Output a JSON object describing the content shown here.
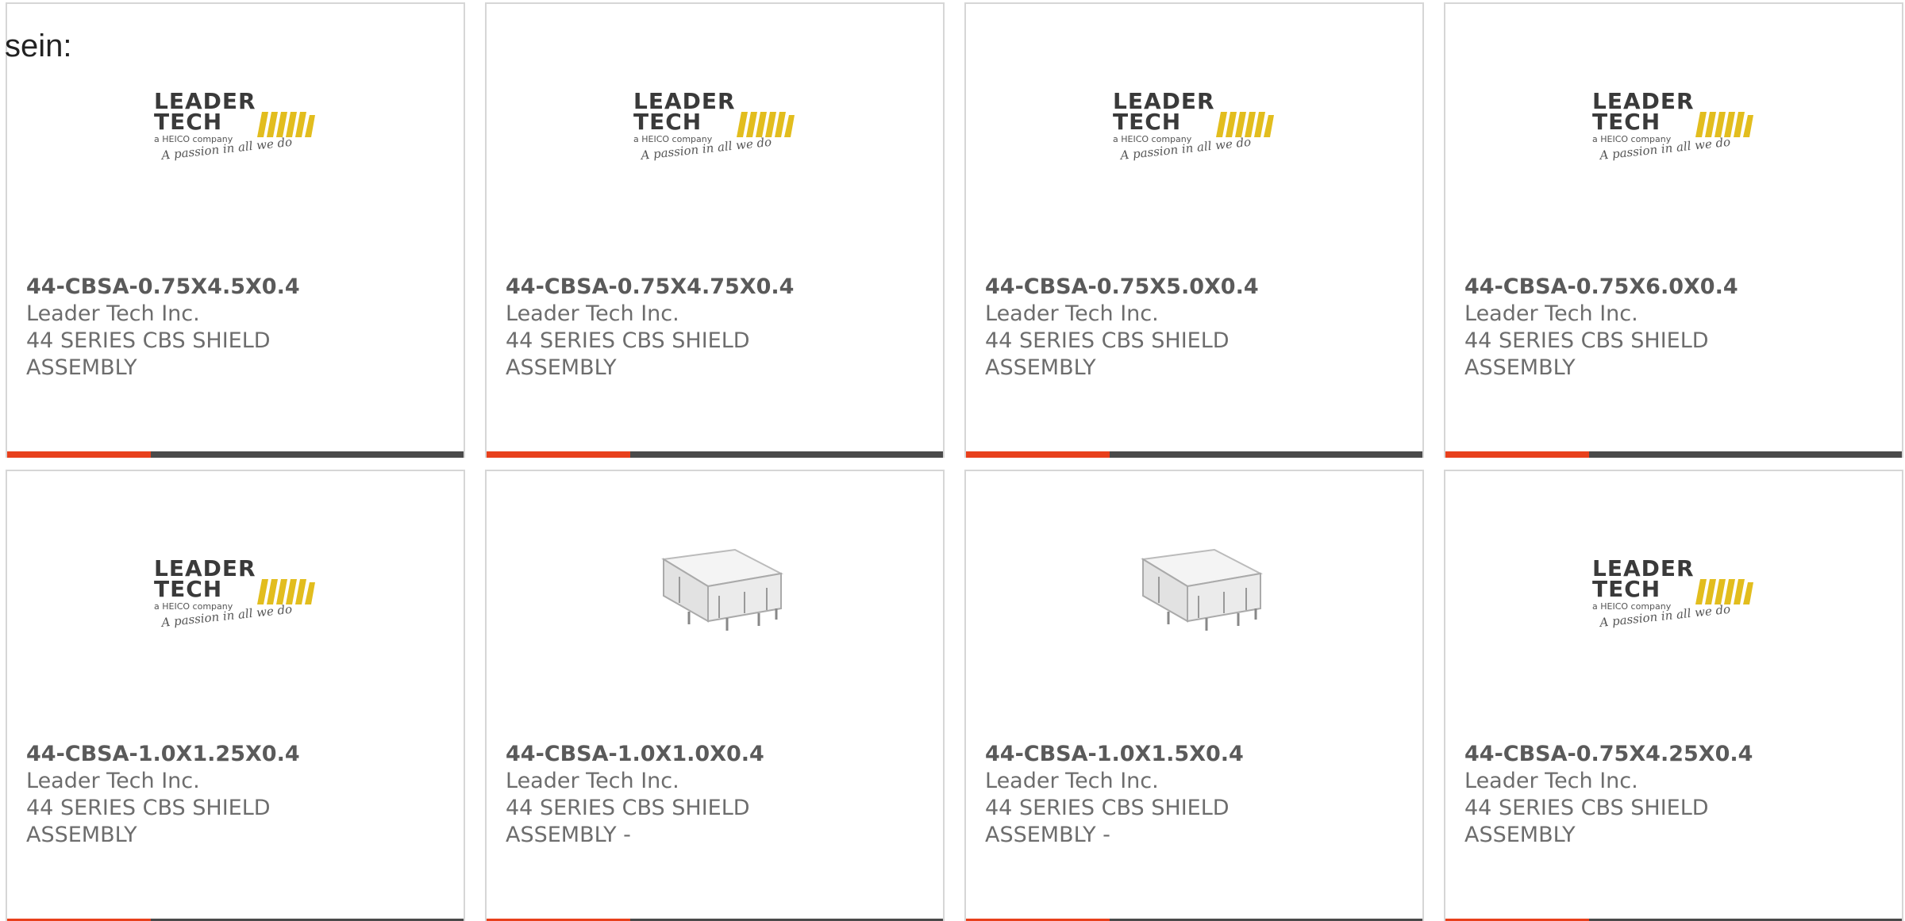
{
  "intro_text": "sein:",
  "accent_color": "#e8401c",
  "bar_color": "#4a4a4a",
  "products": [
    {
      "part": "44-CBSA-0.75X4.5X0.4",
      "manufacturer": "Leader Tech Inc.",
      "description": "44 SERIES CBS SHIELD ASSEMBLY",
      "image": "leader-tech-logo"
    },
    {
      "part": "44-CBSA-0.75X4.75X0.4",
      "manufacturer": "Leader Tech Inc.",
      "description": "44 SERIES CBS SHIELD ASSEMBLY",
      "image": "leader-tech-logo"
    },
    {
      "part": "44-CBSA-0.75X5.0X0.4",
      "manufacturer": "Leader Tech Inc.",
      "description": "44 SERIES CBS SHIELD ASSEMBLY",
      "image": "leader-tech-logo"
    },
    {
      "part": "44-CBSA-0.75X6.0X0.4",
      "manufacturer": "Leader Tech Inc.",
      "description": "44 SERIES CBS SHIELD ASSEMBLY",
      "image": "leader-tech-logo"
    },
    {
      "part": "44-CBSA-1.0X1.25X0.4",
      "manufacturer": "Leader Tech Inc.",
      "description": "44 SERIES CBS SHIELD ASSEMBLY",
      "image": "leader-tech-logo"
    },
    {
      "part": "44-CBSA-1.0X1.0X0.4",
      "manufacturer": "Leader Tech Inc.",
      "description": "44 SERIES CBS SHIELD ASSEMBLY -",
      "image": "shield-product-photo"
    },
    {
      "part": "44-CBSA-1.0X1.5X0.4",
      "manufacturer": "Leader Tech Inc.",
      "description": "44 SERIES CBS SHIELD ASSEMBLY -",
      "image": "shield-product-photo"
    },
    {
      "part": "44-CBSA-0.75X4.25X0.4",
      "manufacturer": "Leader Tech Inc.",
      "description": "44 SERIES CBS SHIELD ASSEMBLY",
      "image": "leader-tech-logo"
    }
  ],
  "logo": {
    "line1": "LEADER",
    "line2": "TECH",
    "tagline": "a HEICO company",
    "slogan": "A passion in all we do",
    "brand_color": "#e2bd1e"
  }
}
